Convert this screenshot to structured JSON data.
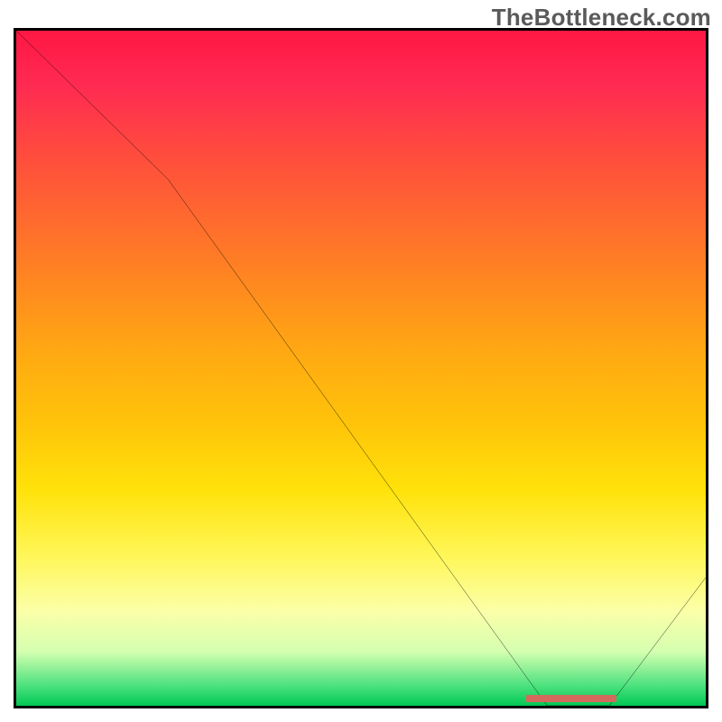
{
  "watermark": "TheBottleneck.com",
  "colors": {
    "border": "#000000",
    "curve": "#000000",
    "marker": "#d46a5e",
    "gradient_top": "#ff1744",
    "gradient_mid": "#ffe20a",
    "gradient_bottom": "#00c853"
  },
  "chart_data": {
    "type": "line",
    "title": "",
    "xlabel": "",
    "ylabel": "",
    "xlim": [
      0,
      100
    ],
    "ylim": [
      0,
      100
    ],
    "grid": false,
    "series": [
      {
        "name": "bottleneck-curve",
        "x": [
          0,
          6,
          22,
          77,
          86,
          100
        ],
        "y": [
          100,
          94,
          78,
          0,
          0,
          19
        ]
      }
    ],
    "annotations": [
      {
        "name": "target-range-marker",
        "x_range": [
          74,
          87
        ],
        "y": 0,
        "color": "#d46a5e"
      }
    ],
    "background_gradient": {
      "direction": "vertical",
      "stops": [
        {
          "pos": 0,
          "color": "#ff1744",
          "meaning": "high-bottleneck"
        },
        {
          "pos": 50,
          "color": "#ffe20a",
          "meaning": "medium"
        },
        {
          "pos": 100,
          "color": "#00c853",
          "meaning": "optimal"
        }
      ]
    }
  }
}
